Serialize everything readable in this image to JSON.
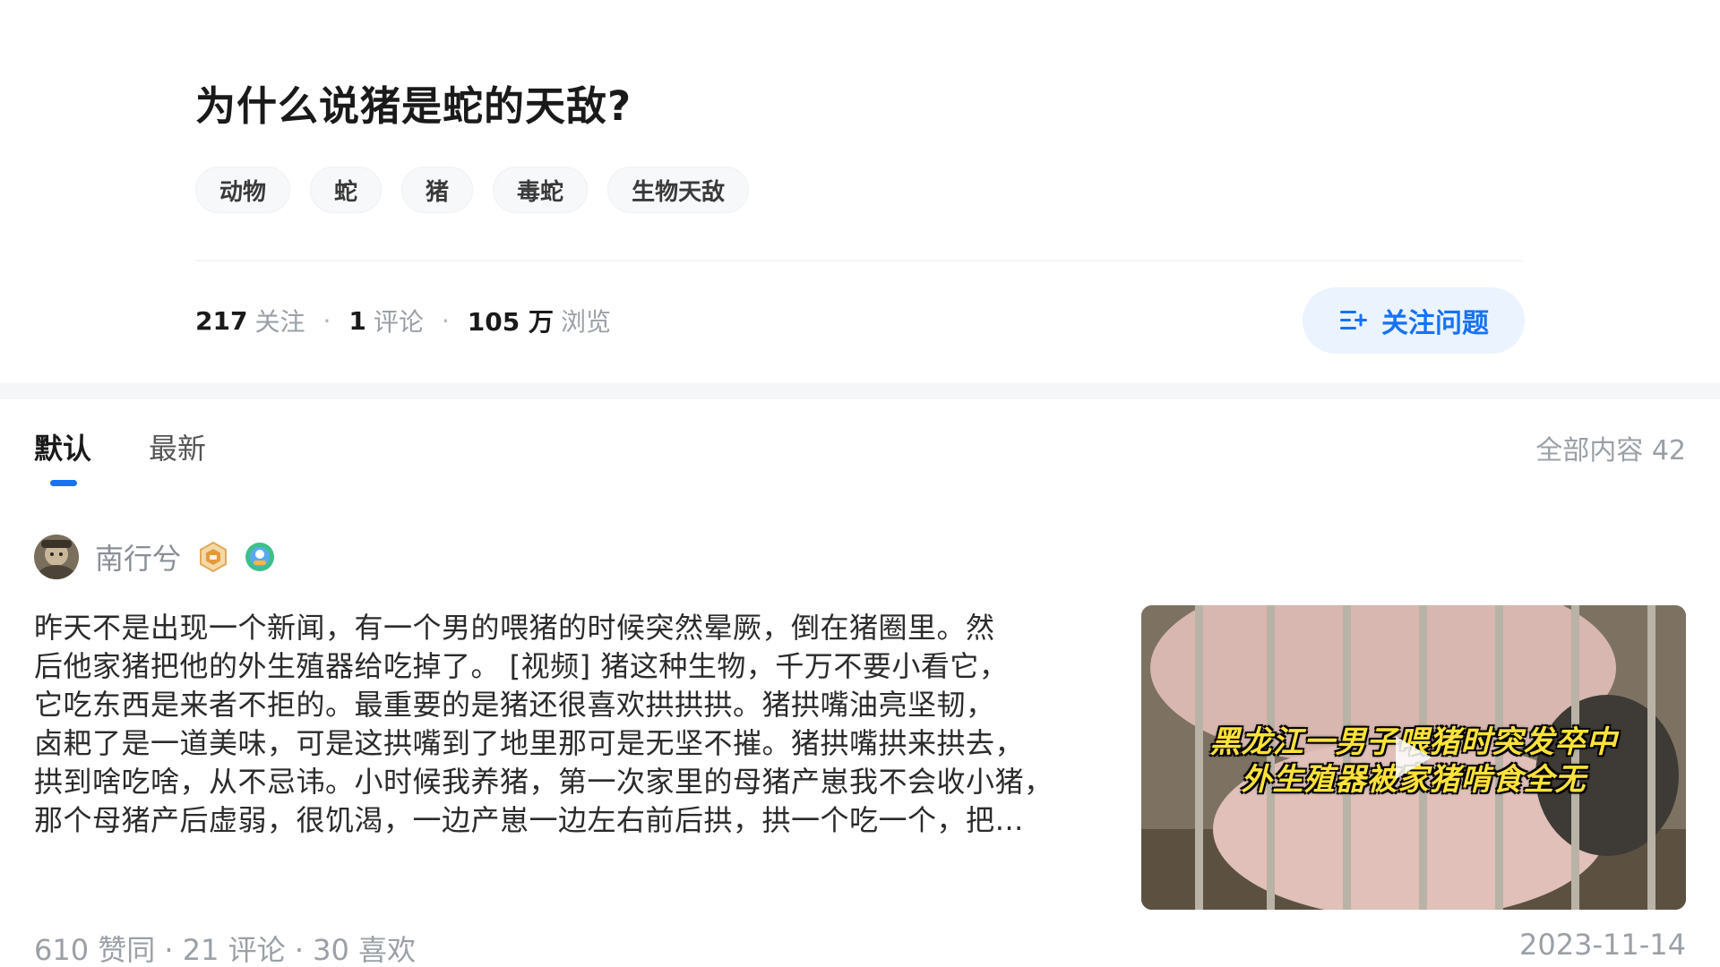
{
  "question": {
    "title": "为什么说猪是蛇的天敌?",
    "tags": [
      "动物",
      "蛇",
      "猪",
      "毒蛇",
      "生物天敌"
    ],
    "stats": {
      "follow_count": "217",
      "follow_label": "关注",
      "comment_count": "1",
      "comment_label": "评论",
      "view_count": "105 万",
      "view_label": "浏览",
      "separator": "·"
    },
    "follow_button_label": "关注问题"
  },
  "tabs": {
    "items": [
      "默认",
      "最新"
    ],
    "active": "默认",
    "total_label": "全部内容 42"
  },
  "answer": {
    "author_name": "南行兮",
    "lines": [
      "昨天不是出现一个新闻，有一个男的喂猪的时候突然晕厥，倒在猪圈里。然",
      "后他家猪把他的外生殖器给吃掉了。 [视频] 猪这种生物，千万不要小看它，",
      "它吃东西是来者不拒的。最重要的是猪还很喜欢拱拱拱。猪拱嘴油亮坚韧，",
      "卤耙了是一道美味，可是这拱嘴到了地里那可是无坚不摧。猪拱嘴拱来拱去，",
      "拱到啥吃啥，从不忌讳。小时候我养猪，第一次家里的母猪产崽我不会收小猪，",
      "那个母猪产后虚弱，很饥渴，一边产崽一边左右前后拱，拱一个吃一个，把…"
    ],
    "video_caption_line1": "黑龙江一男子喂猪时突发卒中",
    "video_caption_line2": "外生殖器被家猪啃食全无",
    "meta": "610 赞同 · 21 评论 · 30 喜欢",
    "date": "2023-11-14"
  },
  "colors": {
    "accent": "#1772f6",
    "muted": "#9aa0a6",
    "follow_bg": "#ebf3ff"
  },
  "icons": [
    "follow-question-icon",
    "author-avatar",
    "author-badge-icon",
    "author-medal-icon",
    "play-icon"
  ]
}
